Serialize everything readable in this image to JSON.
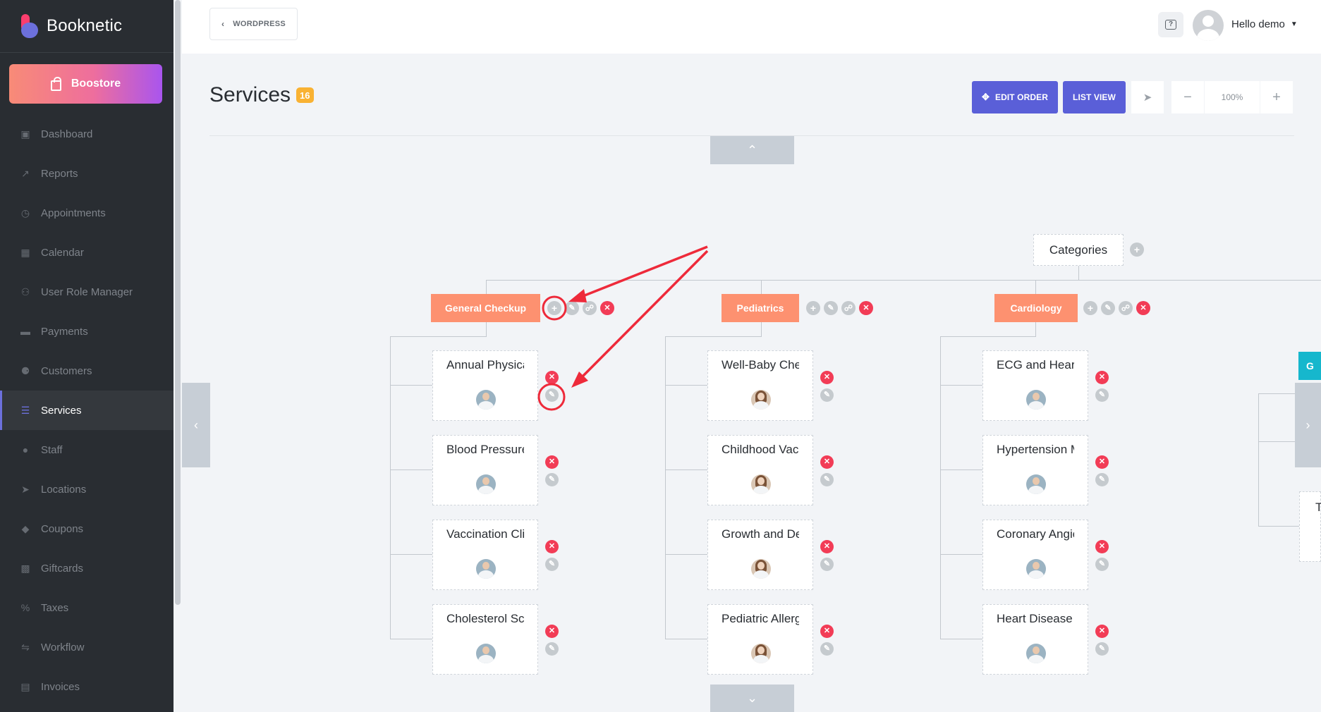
{
  "app": {
    "name": "Booknetic"
  },
  "sidebar": {
    "boostore_label": "Boostore",
    "items": [
      {
        "label": "Dashboard",
        "icon": "dashboard-icon"
      },
      {
        "label": "Reports",
        "icon": "chart-icon"
      },
      {
        "label": "Appointments",
        "icon": "clock-icon"
      },
      {
        "label": "Calendar",
        "icon": "calendar-icon"
      },
      {
        "label": "User Role Manager",
        "icon": "user-plus-icon"
      },
      {
        "label": "Payments",
        "icon": "credit-card-icon"
      },
      {
        "label": "Customers",
        "icon": "users-icon"
      },
      {
        "label": "Services",
        "icon": "list-icon",
        "active": true
      },
      {
        "label": "Staff",
        "icon": "user-icon"
      },
      {
        "label": "Locations",
        "icon": "location-arrow-icon"
      },
      {
        "label": "Coupons",
        "icon": "tag-icon"
      },
      {
        "label": "Giftcards",
        "icon": "gift-icon"
      },
      {
        "label": "Taxes",
        "icon": "percent-icon"
      },
      {
        "label": "Workflow",
        "icon": "workflow-icon"
      },
      {
        "label": "Invoices",
        "icon": "invoice-icon"
      }
    ]
  },
  "header": {
    "back_label": "WORDPRESS",
    "user_greeting": "Hello demo"
  },
  "page": {
    "title": "Services",
    "count": "16",
    "edit_order_label": "EDIT ORDER",
    "list_view_label": "LIST VIEW",
    "zoom": "100%"
  },
  "tree": {
    "root_label": "Categories",
    "categories": [
      {
        "name": "General Checkup",
        "services": [
          "Annual Physical Exam",
          "Blood Pressure Check",
          "Vaccination Clinic",
          "Cholesterol Screening"
        ]
      },
      {
        "name": "Pediatrics",
        "services": [
          "Well-Baby Checkup",
          "Childhood Vaccinations",
          "Growth and Development",
          "Pediatric Allergy"
        ]
      },
      {
        "name": "Cardiology",
        "services": [
          "ECG and Heart Monitoring",
          "Hypertension Management",
          "Coronary Angiography",
          "Heart Disease Screening"
        ]
      }
    ],
    "partial_category_initial": "G",
    "partial_service_initial": "T"
  },
  "colors": {
    "sidebar_bg": "#292d32",
    "accent": "#5a5fd8",
    "category": "#fd9170",
    "delete": "#f23c56",
    "badge": "#f9b233",
    "annotation": "#ee2a3a"
  }
}
